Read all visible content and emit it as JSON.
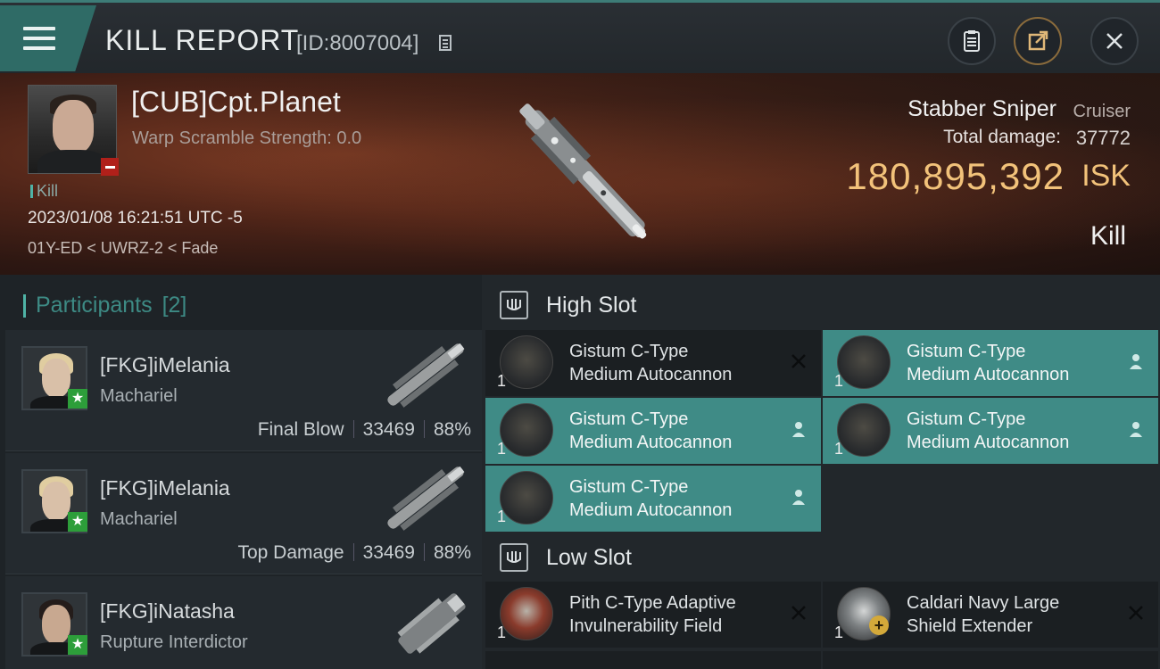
{
  "header": {
    "title": "KILL REPORT",
    "report_id": "[ID:8007004]"
  },
  "victim": {
    "name": "[CUB]Cpt.Planet",
    "warp_scramble": "Warp Scramble Strength: 0.0",
    "kill_tag": "Kill",
    "datetime": "2023/01/08 16:21:51 UTC -5",
    "location": "01Y-ED < UWRZ-2 < Fade",
    "ship_name": "Stabber Sniper",
    "ship_class": "Cruiser",
    "total_damage_label": "Total damage:",
    "total_damage": "37772",
    "isk_value": "180,895,392",
    "isk_unit": "ISK",
    "result": "Kill"
  },
  "participants": {
    "header": "Participants",
    "count": "[2]",
    "rows": [
      {
        "name": "[FKG]iMelania",
        "ship": "Machariel",
        "role": "Final Blow",
        "damage": "33469",
        "percent": "88%"
      },
      {
        "name": "[FKG]iMelania",
        "ship": "Machariel",
        "role": "Top Damage",
        "damage": "33469",
        "percent": "88%"
      },
      {
        "name": "[FKG]iNatasha",
        "ship": "Rupture Interdictor"
      }
    ]
  },
  "high_slot": {
    "title": "High Slot",
    "modules": [
      {
        "line1": "Gistum C-Type",
        "line2": "Medium Autocannon",
        "qty": "1"
      },
      {
        "line1": "Gistum C-Type",
        "line2": "Medium Autocannon",
        "qty": "1"
      },
      {
        "line1": "Gistum C-Type",
        "line2": "Medium Autocannon",
        "qty": "1"
      },
      {
        "line1": "Gistum C-Type",
        "line2": "Medium Autocannon",
        "qty": "1"
      },
      {
        "line1": "Gistum C-Type",
        "line2": "Medium Autocannon",
        "qty": "1"
      }
    ]
  },
  "low_slot": {
    "title": "Low Slot",
    "modules": [
      {
        "line1": "Pith C-Type Adaptive",
        "line2": "Invulnerability Field",
        "qty": "1"
      },
      {
        "line1": "Caldari Navy Large",
        "line2": "Shield Extender",
        "qty": "1"
      }
    ]
  },
  "colors": {
    "accent": "#3f8b86",
    "isk": "#f2c27a",
    "badge_red": "#b0201a",
    "badge_green": "#2d9e3a"
  }
}
